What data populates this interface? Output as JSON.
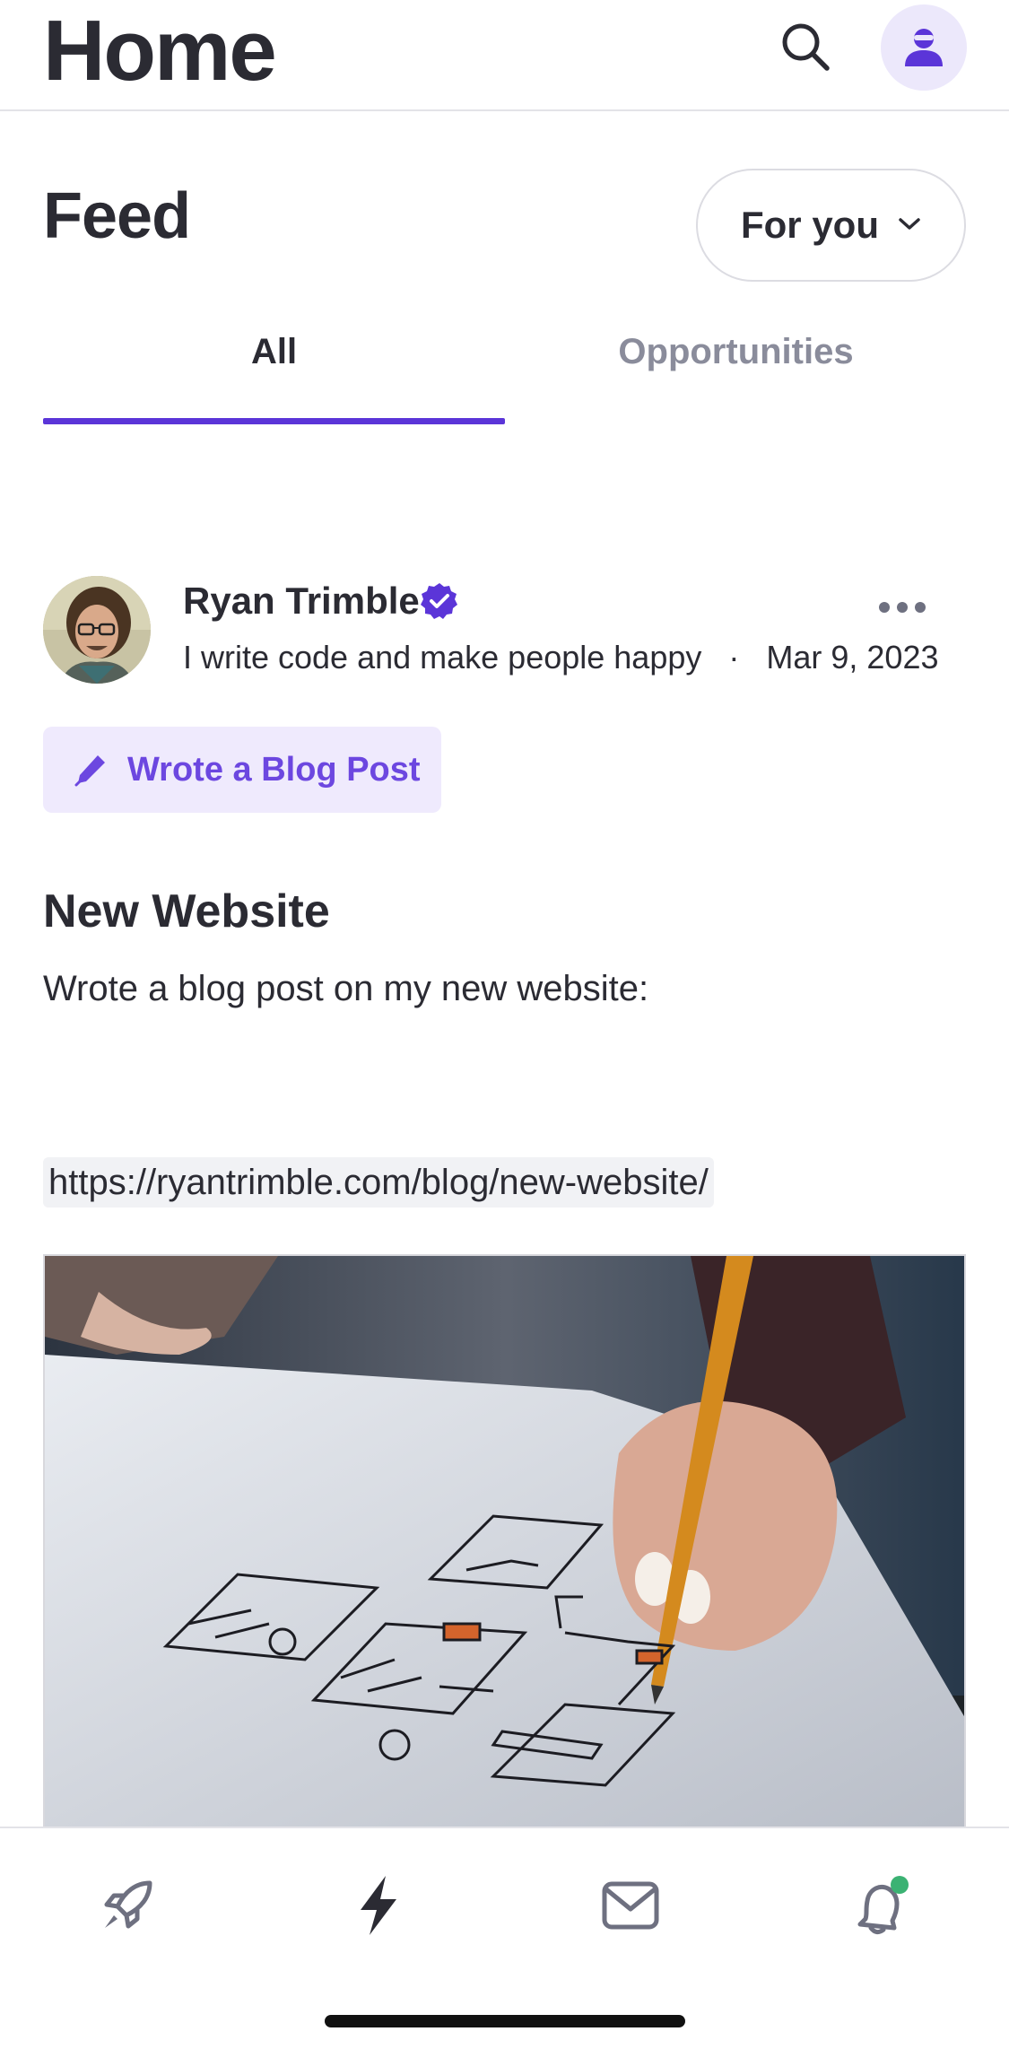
{
  "header": {
    "title": "Home",
    "search_icon": "search-icon",
    "profile_icon": "user-avatar-icon"
  },
  "feed": {
    "title": "Feed",
    "filter": {
      "selected": "For you",
      "icon": "chevron-down-icon"
    },
    "tabs": [
      {
        "label": "All",
        "active": true
      },
      {
        "label": "Opportunities",
        "active": false
      }
    ]
  },
  "post": {
    "author": {
      "name": "Ryan Trimble",
      "verified": true,
      "tagline": "I write code and make people happy",
      "separator": "·",
      "date": "Mar 9, 2023"
    },
    "badge": {
      "icon": "pen-icon",
      "label": "Wrote a Blog Post"
    },
    "title": "New Website",
    "body": "Wrote a blog post on my new website:",
    "link": "https://ryantrimble.com/blog/new-website/",
    "image_icon": "wireframe-sketch-photo"
  },
  "bottom_nav": {
    "items": [
      {
        "icon": "rocket-icon"
      },
      {
        "icon": "lightning-icon",
        "active": true
      },
      {
        "icon": "mail-icon"
      },
      {
        "icon": "bell-icon",
        "has_notification": true
      }
    ]
  },
  "colors": {
    "accent": "#5b35d8",
    "badge_bg": "#efeafd",
    "badge_text": "#6c47e0",
    "notification_dot": "#3bb273",
    "text": "#2b2b33",
    "muted": "#8a8c9b"
  }
}
